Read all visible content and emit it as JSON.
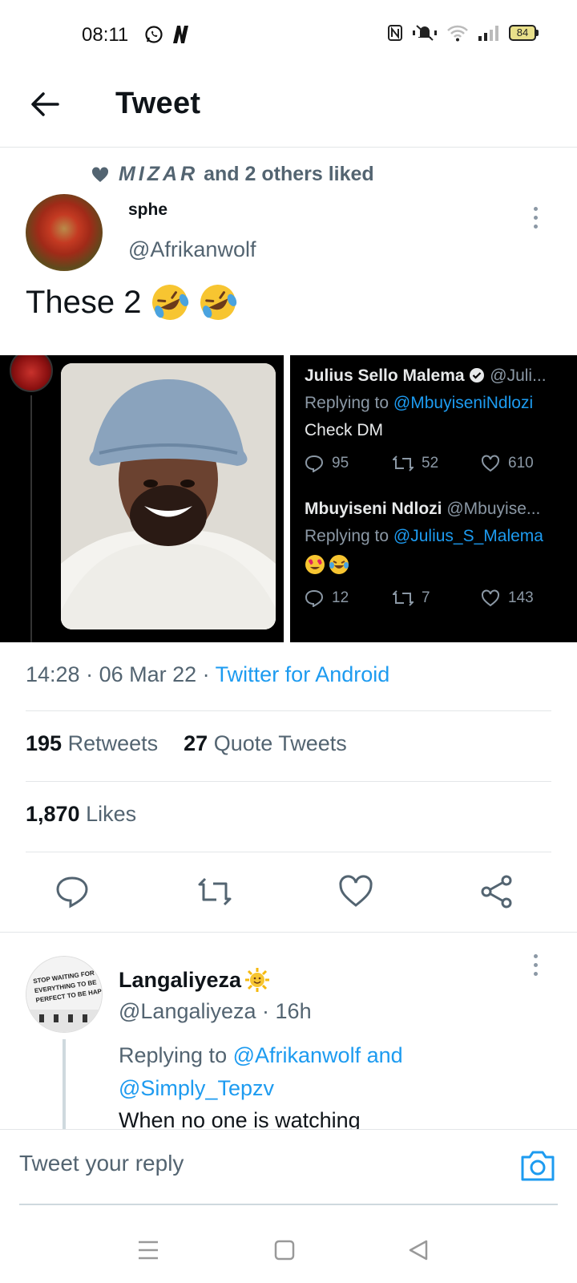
{
  "status_bar": {
    "time": "08:11",
    "battery": "84",
    "icons": [
      "whatsapp-icon",
      "n-app-icon",
      "nfc-icon",
      "mute-icon",
      "wifi-icon",
      "signal-icon",
      "battery-icon"
    ]
  },
  "header": {
    "title": "Tweet",
    "back_icon": "arrow-left-icon"
  },
  "tweet": {
    "social_context_highlight": "MIZAR",
    "social_context_rest": "and 2 others liked",
    "author_name": "sphe",
    "author_handle": "@Afrikanwolf",
    "text": "These 2",
    "emoji": "rolling-on-floor-laughing x2",
    "media_right": {
      "item1": {
        "name": "Julius Sello Malema",
        "handle": "@Juli...",
        "replying_prefix": "Replying to",
        "replying_to": "@MbuyiseniNdlozi",
        "text": "Check DM",
        "replies": "95",
        "retweets": "52",
        "likes": "610"
      },
      "item2": {
        "name": "Mbuyiseni Ndlozi",
        "handle": "@Mbuyise...",
        "replying_prefix": "Replying to",
        "replying_to": "@Julius_S_Malema",
        "replies": "12",
        "retweets": "7",
        "likes": "143"
      }
    },
    "time": "14:28",
    "date": "06 Mar 22",
    "source": "Twitter for Android",
    "retweets_count": "195",
    "retweets_label": "Retweets",
    "quote_count": "27",
    "quote_label": "Quote Tweets",
    "likes_count": "1,870",
    "likes_label": "Likes"
  },
  "reply": {
    "name": "Langaliyeza",
    "handle": "@Langaliyeza",
    "age": "16h",
    "replying_prefix": "Replying to",
    "replying_to_1": "@Afrikanwolf",
    "replying_and": "and",
    "replying_to_2": "@Simply_Tepzv",
    "text": "When no one is watching",
    "avatar_sign_text": "STOP WAITING FOR EVERYTHING TO BE PERFECT TO BE HAPPY"
  },
  "composer": {
    "placeholder": "Tweet your reply"
  },
  "colors": {
    "link": "#1d9bf0",
    "secondary": "#536471",
    "text": "#0f1419"
  }
}
